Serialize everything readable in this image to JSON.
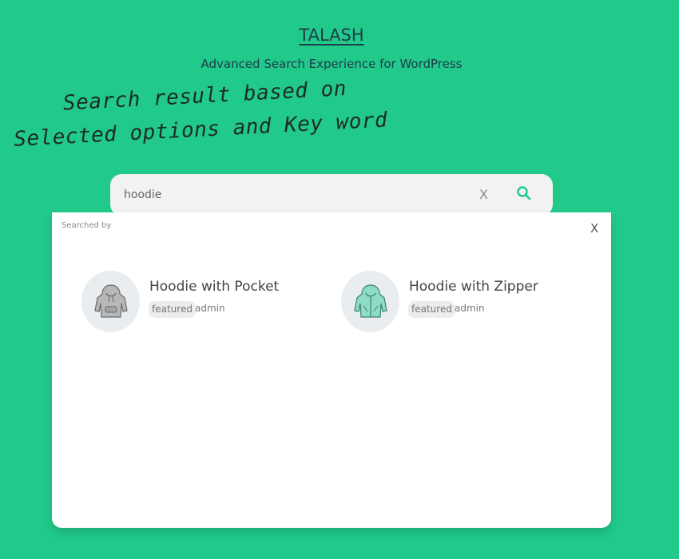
{
  "header": {
    "title": "TALASH",
    "subtitle": "Advanced Search Experience for WordPress"
  },
  "note": {
    "line1": "Search result based on",
    "line2": "Selected options and Key word"
  },
  "search": {
    "value": "hoodie",
    "clear_label": "X",
    "icon": "search-icon"
  },
  "results_panel": {
    "searched_by_label": "Searched by",
    "close_label": "X",
    "items": [
      {
        "title": "Hoodie with Pocket",
        "badge": "featured",
        "author": "admin",
        "color": "#9a9a9a"
      },
      {
        "title": "Hoodie with Zipper",
        "badge": "featured",
        "author": "admin",
        "color": "#7fd4be"
      }
    ]
  },
  "colors": {
    "background": "#21c98a",
    "accent": "#21c98a",
    "panel": "#ffffff"
  }
}
